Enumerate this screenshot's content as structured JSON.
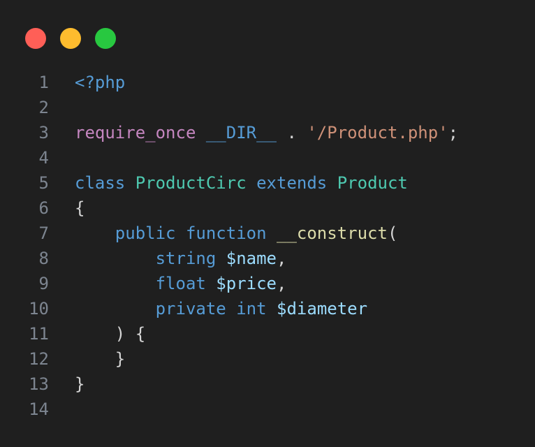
{
  "window_controls": {
    "close_color": "#ff5f57",
    "minimize_color": "#febc2e",
    "maximize_color": "#28c840"
  },
  "code_lines": [
    {
      "n": "1",
      "tokens": [
        {
          "t": "<?php",
          "c": "kw"
        }
      ]
    },
    {
      "n": "2",
      "tokens": []
    },
    {
      "n": "3",
      "tokens": [
        {
          "t": "require_once",
          "c": "inc"
        },
        {
          "t": " ",
          "c": "pl"
        },
        {
          "t": "__DIR__",
          "c": "kw"
        },
        {
          "t": " . ",
          "c": "pl"
        },
        {
          "t": "'/Product.php'",
          "c": "str"
        },
        {
          "t": ";",
          "c": "pl"
        }
      ]
    },
    {
      "n": "4",
      "tokens": []
    },
    {
      "n": "5",
      "tokens": [
        {
          "t": "class",
          "c": "kw"
        },
        {
          "t": " ",
          "c": "pl"
        },
        {
          "t": "ProductCirc",
          "c": "cls"
        },
        {
          "t": " ",
          "c": "pl"
        },
        {
          "t": "extends",
          "c": "kw"
        },
        {
          "t": " ",
          "c": "pl"
        },
        {
          "t": "Product",
          "c": "cls"
        }
      ]
    },
    {
      "n": "6",
      "tokens": [
        {
          "t": "{",
          "c": "pl"
        }
      ]
    },
    {
      "n": "7",
      "tokens": [
        {
          "t": "    ",
          "c": "pl"
        },
        {
          "t": "public",
          "c": "kw"
        },
        {
          "t": " ",
          "c": "pl"
        },
        {
          "t": "function",
          "c": "kw"
        },
        {
          "t": " ",
          "c": "pl"
        },
        {
          "t": "__construct",
          "c": "fn"
        },
        {
          "t": "(",
          "c": "pl"
        }
      ]
    },
    {
      "n": "8",
      "tokens": [
        {
          "t": "        ",
          "c": "pl"
        },
        {
          "t": "string",
          "c": "kw"
        },
        {
          "t": " ",
          "c": "pl"
        },
        {
          "t": "$name",
          "c": "var"
        },
        {
          "t": ",",
          "c": "pl"
        }
      ]
    },
    {
      "n": "9",
      "tokens": [
        {
          "t": "        ",
          "c": "pl"
        },
        {
          "t": "float",
          "c": "kw"
        },
        {
          "t": " ",
          "c": "pl"
        },
        {
          "t": "$price",
          "c": "var"
        },
        {
          "t": ",",
          "c": "pl"
        }
      ]
    },
    {
      "n": "10",
      "tokens": [
        {
          "t": "        ",
          "c": "pl"
        },
        {
          "t": "private",
          "c": "kw"
        },
        {
          "t": " ",
          "c": "pl"
        },
        {
          "t": "int",
          "c": "kw"
        },
        {
          "t": " ",
          "c": "pl"
        },
        {
          "t": "$diameter",
          "c": "var"
        }
      ]
    },
    {
      "n": "11",
      "tokens": [
        {
          "t": "    ",
          "c": "pl"
        },
        {
          "t": ") {",
          "c": "pl"
        }
      ]
    },
    {
      "n": "12",
      "tokens": [
        {
          "t": "    ",
          "c": "pl"
        },
        {
          "t": "}",
          "c": "pl"
        }
      ]
    },
    {
      "n": "13",
      "tokens": [
        {
          "t": "}",
          "c": "pl"
        }
      ]
    },
    {
      "n": "14",
      "tokens": []
    }
  ]
}
